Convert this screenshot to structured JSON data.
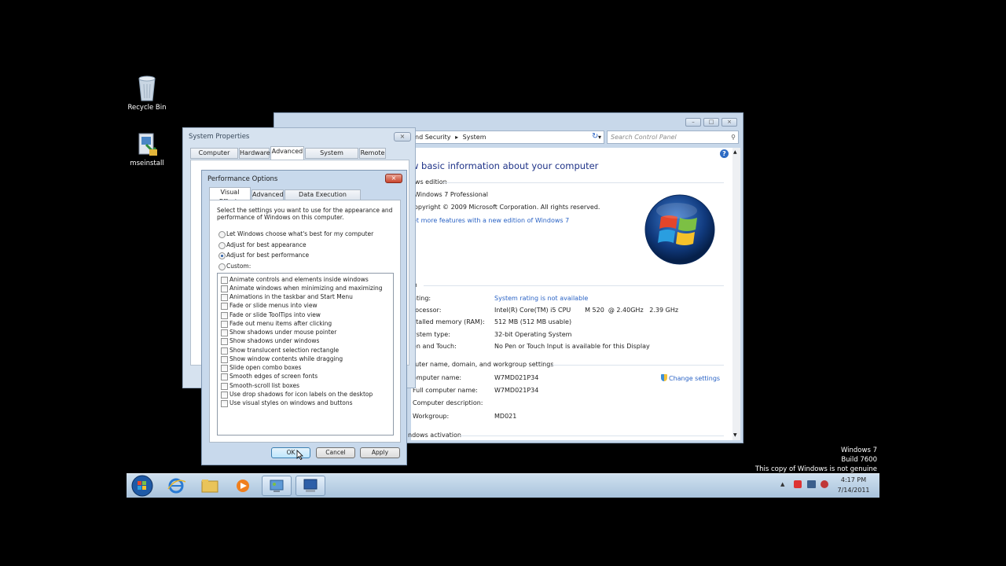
{
  "desktop": {
    "icons": [
      {
        "label": "Recycle Bin",
        "icon": "recycle-bin-icon"
      },
      {
        "label": "mseinstall",
        "icon": "installer-icon"
      }
    ],
    "watermark": [
      "Windows 7",
      "Build 7600",
      "This copy of Windows is not genuine"
    ]
  },
  "taskbar": {
    "clock_time": "4:17 PM",
    "clock_date": "7/14/2011",
    "pinned": [
      "start-orb-icon",
      "internet-explorer-icon",
      "explorer-folder-icon",
      "media-player-icon",
      "control-panel-icon",
      "system-properties-icon"
    ]
  },
  "control_panel": {
    "breadcrumb_part": "nd Security",
    "breadcrumb_current": "System",
    "search_placeholder": "Search Control Panel",
    "heading": "w basic information about your computer",
    "edition_header": "ows edition",
    "edition_name": "Windows 7 Professional",
    "copyright": "opyright © 2009 Microsoft Corporation.  All rights reserved.",
    "more_features_link": "et more features with a new edition of Windows 7",
    "system_header": "m",
    "rows": [
      {
        "label": "ating:",
        "value": "System rating is not available",
        "link": true
      },
      {
        "label": "rocessor:",
        "value": "Intel(R) Core(TM) i5 CPU       M 520  @ 2.40GHz   2.39 GHz",
        "link": false
      },
      {
        "label": "stalled memory (RAM):",
        "value": "512 MB (512 MB usable)",
        "link": false
      },
      {
        "label": "ystem type:",
        "value": "32-bit Operating System",
        "link": false
      },
      {
        "label": "en and Touch:",
        "value": "No Pen or Touch Input is available for this Display",
        "link": false
      }
    ],
    "computer_header": "puter name, domain, and workgroup settings",
    "computer_rows": [
      {
        "label": "omputer name:",
        "value": "W7MD021P34"
      },
      {
        "label": "Full computer name:",
        "value": "W7MD021P34"
      },
      {
        "label": "Computer description:",
        "value": ""
      },
      {
        "label": "Workgroup:",
        "value": "MD021"
      }
    ],
    "change_settings": "Change settings",
    "activation_header": "ndows activation"
  },
  "system_properties": {
    "title": "System Properties",
    "tabs": [
      "Computer Name",
      "Hardware",
      "Advanced",
      "System Protection",
      "Remote"
    ],
    "selected_tab": "Advanced"
  },
  "performance_options": {
    "title": "Performance Options",
    "tabs": [
      "Visual Effects",
      "Advanced",
      "Data Execution Prevention"
    ],
    "description": [
      "Select the settings you want to use for the appearance and",
      "performance of Windows on this computer."
    ],
    "radios": [
      {
        "label": "Let Windows choose what's best for my computer",
        "selected": false
      },
      {
        "label": "Adjust for best appearance",
        "selected": false
      },
      {
        "label": "Adjust for best performance",
        "selected": true
      },
      {
        "label": "Custom:",
        "selected": false
      }
    ],
    "effects": [
      "Animate controls and elements inside windows",
      "Animate windows when minimizing and maximizing",
      "Animations in the taskbar and Start Menu",
      "Fade or slide menus into view",
      "Fade or slide ToolTips into view",
      "Fade out menu items after clicking",
      "Show shadows under mouse pointer",
      "Show shadows under windows",
      "Show translucent selection rectangle",
      "Show window contents while dragging",
      "Slide open combo boxes",
      "Smooth edges of screen fonts",
      "Smooth-scroll list boxes",
      "Use drop shadows for icon labels on the desktop",
      "Use visual styles on windows and buttons"
    ],
    "buttons": {
      "ok": "OK",
      "cancel": "Cancel",
      "apply": "Apply"
    }
  }
}
